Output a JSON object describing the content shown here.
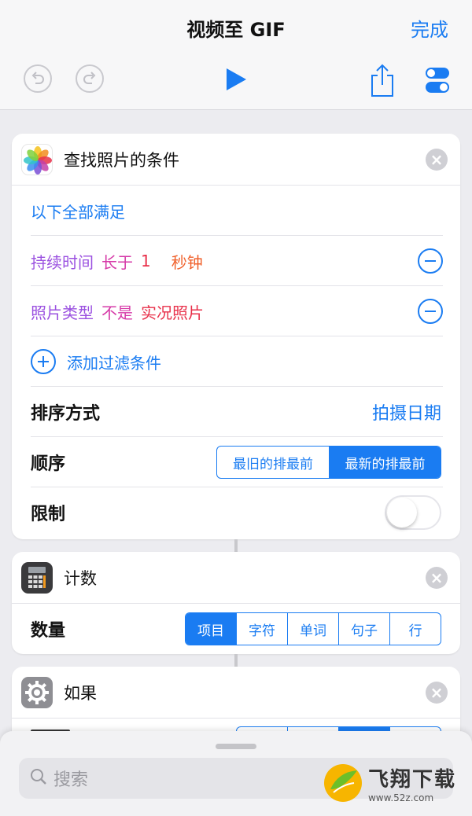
{
  "nav": {
    "title": "视频至 GIF",
    "done": "完成"
  },
  "card_photos": {
    "title": "查找照片的条件",
    "match": "以下全部满足",
    "filter1": {
      "field": "持续时间",
      "op": "长于",
      "value": "1",
      "unit": "秒钟"
    },
    "filter2": {
      "field": "照片类型",
      "op": "不是",
      "value": "实况照片"
    },
    "add_filter": "添加过滤条件",
    "sort_label": "排序方式",
    "sort_value": "拍摄日期",
    "order_label": "顺序",
    "order_options": [
      "最旧的排最前",
      "最新的排最前"
    ],
    "order_selected": "最新的排最前",
    "limit_label": "限制",
    "limit_on": false
  },
  "card_count": {
    "title": "计数",
    "label": "数量",
    "options": [
      "项目",
      "字符",
      "单词",
      "句子",
      "行"
    ],
    "selected": "项目"
  },
  "card_if": {
    "title": "如果"
  },
  "search": {
    "placeholder": "搜索"
  },
  "watermark": {
    "name": "飞翔下载",
    "url": "www.52z.com"
  },
  "colors": {
    "accent": "#1a7cf2",
    "variable_purple": "#9b51e0",
    "operator_magenta": "#d63aa8",
    "unit_orange": "#f0612c"
  },
  "icons": [
    "undo-icon",
    "redo-icon",
    "play-icon",
    "share-icon",
    "settings-toggle-icon",
    "photos-app-icon",
    "calculator-icon",
    "gear-icon",
    "close-icon",
    "search-icon"
  ]
}
